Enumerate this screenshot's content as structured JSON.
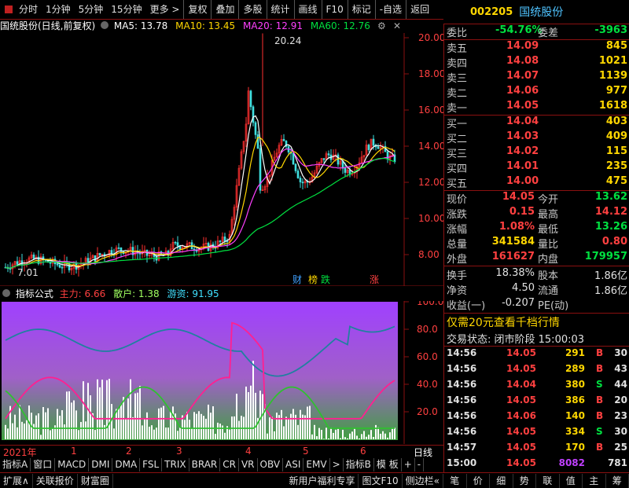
{
  "toolbar": {
    "items": [
      "分时",
      "1分钟",
      "5分钟",
      "15分钟",
      "更多 >",
      "复权",
      "叠加",
      "多股",
      "统计",
      "画线",
      "F10",
      "标记",
      "-自选",
      "返回"
    ]
  },
  "header": {
    "code": "002205",
    "name": "国统股份"
  },
  "chart": {
    "title_prefix": "国统股份(日线,前复权)",
    "ma5": "MA5: 13.78",
    "ma10": "MA10: 13.45",
    "ma20": "MA20: 12.91",
    "ma60": "MA60: 12.76",
    "high_label": "20.24",
    "low_label": "7.01",
    "y_ticks": [
      "20.00",
      "18.00",
      "16.00",
      "14.00",
      "12.00",
      "10.00",
      "8.00"
    ],
    "tags": [
      "财",
      "榜",
      "跌",
      "涨"
    ]
  },
  "indicator": {
    "title": "指标公式",
    "zhuli": "主力: 6.66",
    "sanhu": "散户: 1.38",
    "youzi": "游资: 91.95",
    "y_ticks": [
      "100.0",
      "80.0",
      "60.0",
      "40.0",
      "20.0"
    ]
  },
  "timeline": {
    "year": "2021年",
    "months": [
      "1",
      "2",
      "3",
      "4",
      "5",
      "6"
    ],
    "period": "日线"
  },
  "quote": {
    "weibi_label": "委比",
    "weibi": "-54.76%",
    "weicha_label": "委差",
    "weicha": "-3963",
    "asks": [
      {
        "label": "卖五",
        "price": "14.09",
        "vol": "845"
      },
      {
        "label": "卖四",
        "price": "14.08",
        "vol": "1021"
      },
      {
        "label": "卖三",
        "price": "14.07",
        "vol": "1139"
      },
      {
        "label": "卖二",
        "price": "14.06",
        "vol": "977"
      },
      {
        "label": "卖一",
        "price": "14.05",
        "vol": "1618"
      }
    ],
    "bids": [
      {
        "label": "买一",
        "price": "14.04",
        "vol": "403"
      },
      {
        "label": "买二",
        "price": "14.03",
        "vol": "409"
      },
      {
        "label": "买三",
        "price": "14.02",
        "vol": "115"
      },
      {
        "label": "买四",
        "price": "14.01",
        "vol": "235"
      },
      {
        "label": "买五",
        "price": "14.00",
        "vol": "475"
      }
    ],
    "stats": [
      {
        "l1": "现价",
        "v1": "14.05",
        "l2": "今开",
        "v2": "13.62"
      },
      {
        "l1": "涨跌",
        "v1": "0.15",
        "l2": "最高",
        "v2": "14.12"
      },
      {
        "l1": "涨幅",
        "v1": "1.08%",
        "l2": "最低",
        "v2": "13.26"
      },
      {
        "l1": "总量",
        "v1": "341584",
        "l2": "量比",
        "v2": "0.80"
      },
      {
        "l1": "外盘",
        "v1": "161627",
        "l2": "内盘",
        "v2": "179957"
      }
    ],
    "fin": [
      {
        "l1": "换手",
        "v1": "18.38%",
        "l2": "股本",
        "v2": "1.86亿"
      },
      {
        "l1": "净资",
        "v1": "4.50",
        "l2": "流通",
        "v2": "1.86亿"
      },
      {
        "l1": "收益(一)",
        "v1": "-0.207",
        "l2": "PE(动)",
        "v2": ""
      }
    ],
    "promo": "仅需20元查看千档行情",
    "status": "交易状态: 闭市阶段 15:00:03"
  },
  "ticks": [
    {
      "t": "14:56",
      "p": "14.05",
      "v": "291",
      "d": "B",
      "n": "30"
    },
    {
      "t": "14:56",
      "p": "14.05",
      "v": "289",
      "d": "B",
      "n": "43"
    },
    {
      "t": "14:56",
      "p": "14.04",
      "v": "380",
      "d": "S",
      "n": "44"
    },
    {
      "t": "14:56",
      "p": "14.05",
      "v": "386",
      "d": "B",
      "n": "20"
    },
    {
      "t": "14:56",
      "p": "14.06",
      "v": "140",
      "d": "B",
      "n": "23"
    },
    {
      "t": "14:56",
      "p": "14.05",
      "v": "334",
      "d": "S",
      "n": "30"
    },
    {
      "t": "14:57",
      "p": "14.05",
      "v": "170",
      "d": "B",
      "n": "25"
    },
    {
      "t": "15:00",
      "p": "14.05",
      "v": "8082",
      "d": "",
      "n": "781"
    }
  ],
  "tabs": [
    "指标A",
    "窗口",
    "MACD",
    "DMI",
    "DMA",
    "FSL",
    "TRIX",
    "BRAR",
    "CR",
    "VR",
    "OBV",
    "ASI",
    "EMV",
    ">",
    "指标B",
    "模 板",
    "+",
    "-"
  ],
  "bottombar": {
    "left": [
      "扩展∧",
      "关联报价",
      "财富圈"
    ],
    "right": [
      "新用户福利专享",
      "图文F10",
      "侧边栏«"
    ],
    "nav": [
      "笔",
      "价",
      "细",
      "势",
      "联",
      "值",
      "主",
      "筹"
    ]
  }
}
